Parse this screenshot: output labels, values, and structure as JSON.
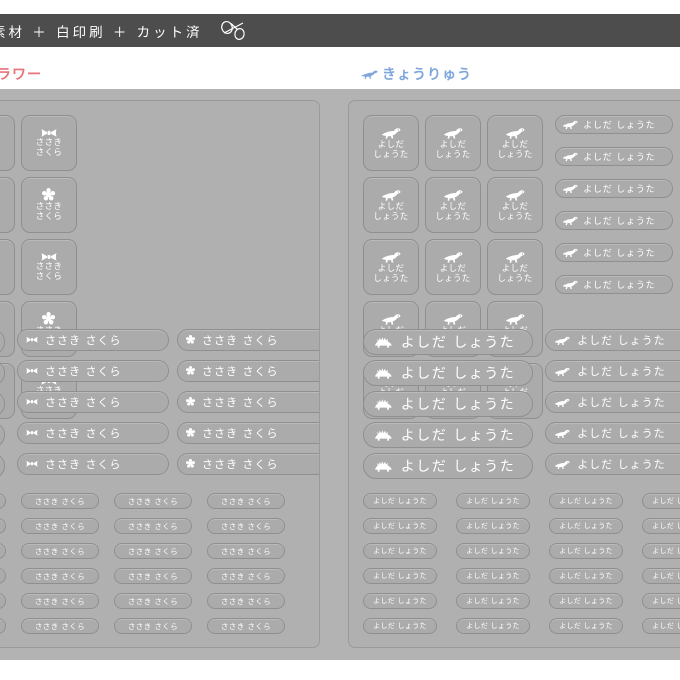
{
  "header": {
    "banner_text": "素材 ＋ 白印刷 ＋ カット済",
    "scissors_icon": "scissors-icon",
    "banner_bg": "#4d4d4d",
    "banner_fg": "#ffffff"
  },
  "categories": {
    "left": {
      "label": "フラワー",
      "color": "#e8737b"
    },
    "right": {
      "label": "きょうりゅう",
      "color": "#7fa6dd",
      "icon": "dinosaur-icon"
    }
  },
  "stage": {
    "background": "#b3b3b3",
    "sheet_background": "#b0b0b0",
    "sticker_background": "#ababab",
    "sticker_border": "#8f8f8f",
    "text_color": "#ffffff"
  },
  "sheets": [
    {
      "id": "sheet-flower",
      "theme": "flower",
      "name": "ささき さくら",
      "icons": [
        "ribbon-icon",
        "flower-icon"
      ],
      "groups": [
        {
          "id": "flower-square-grid",
          "style": "square",
          "rows": 5,
          "cols": 4,
          "label": "ささき さくら"
        },
        {
          "id": "flower-big-pills",
          "style": "big",
          "rows": 5,
          "cols": 3,
          "label": "ささき さくら"
        },
        {
          "id": "flower-small-pills",
          "style": "small",
          "rows": 6,
          "cols": 5,
          "label": "ささき さくら"
        }
      ]
    },
    {
      "id": "sheet-dinosaur",
      "theme": "dinosaur",
      "name": "よしだ しょうた",
      "icons": [
        "dinosaur-icon",
        "stegosaurus-icon"
      ],
      "groups": [
        {
          "id": "dino-square-grid",
          "style": "square",
          "rows": 5,
          "cols": 3,
          "label": "よしだ しょうた"
        },
        {
          "id": "dino-big-pills",
          "style": "big",
          "rows": 5,
          "cols": 3,
          "label": "よしだ しょうた"
        },
        {
          "id": "dino-small-pills",
          "style": "small",
          "rows": 6,
          "cols": 5,
          "label": "よしだ しょうた"
        }
      ]
    }
  ]
}
